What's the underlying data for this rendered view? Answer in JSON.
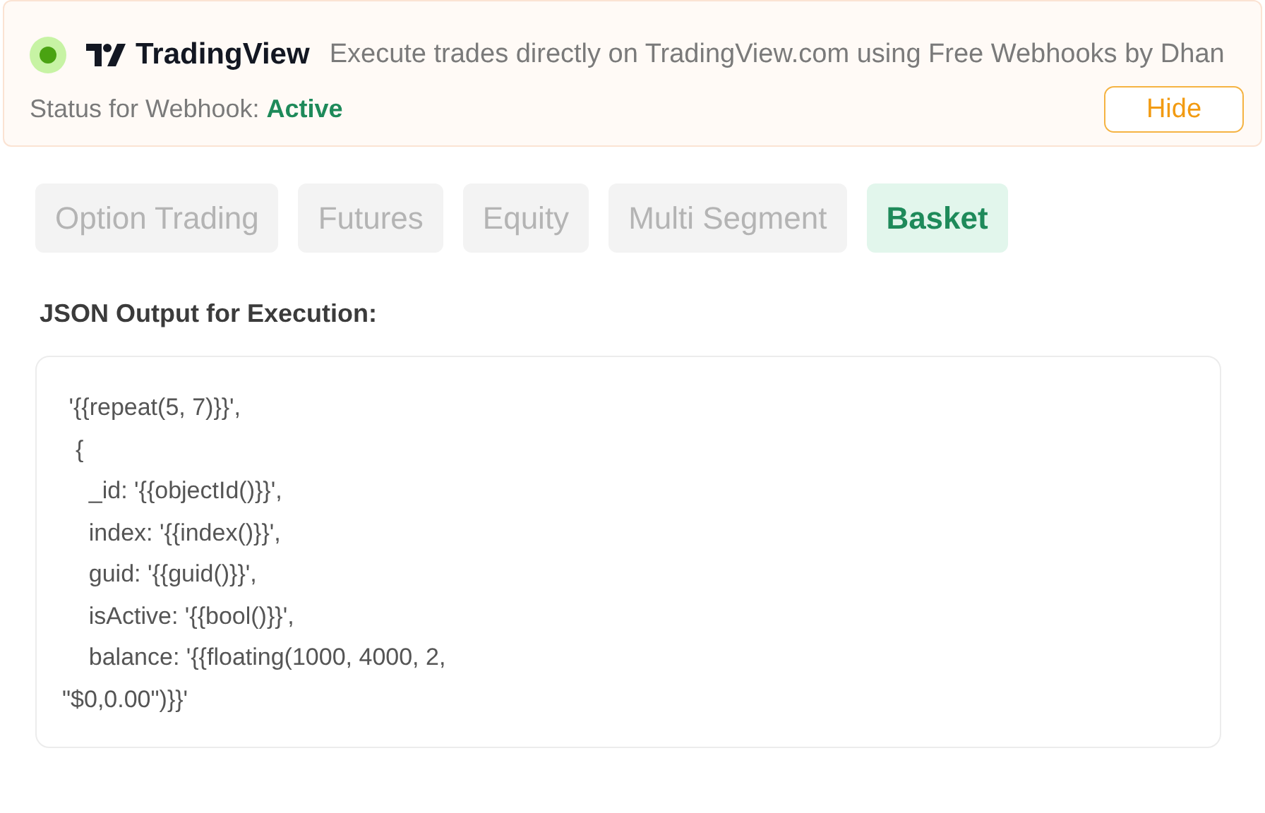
{
  "banner": {
    "status_on": true,
    "brand": "TradingView",
    "description": "Execute trades directly on TradingView.com using Free Webhooks by Dhan",
    "status_label": "Status for Webhook:",
    "status_value": "Active",
    "hide_button": "Hide"
  },
  "tabs": [
    {
      "label": "Option Trading",
      "selected": false
    },
    {
      "label": "Futures",
      "selected": false
    },
    {
      "label": "Equity",
      "selected": false
    },
    {
      "label": "Multi Segment",
      "selected": false
    },
    {
      "label": "Basket",
      "selected": true
    }
  ],
  "output": {
    "heading": "JSON Output for Execution:",
    "lines": [
      " '{{repeat(5, 7)}}',",
      "  {",
      "    _id: '{{objectId()}}',",
      "    index: '{{index()}}',",
      "    guid: '{{guid()}}',",
      "    isActive: '{{bool()}}',",
      "    balance: '{{floating(1000, 4000, 2,",
      "\"$0,0.00\")}}'"
    ]
  }
}
